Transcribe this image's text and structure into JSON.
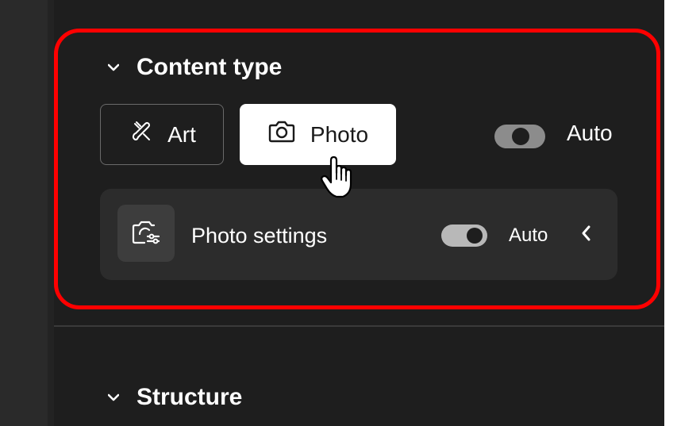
{
  "sections": {
    "content_type": {
      "title": "Content type",
      "art_label": "Art",
      "photo_label": "Photo",
      "auto_label": "Auto",
      "auto_enabled": false,
      "selected": "Photo"
    },
    "photo_settings": {
      "label": "Photo settings",
      "auto_label": "Auto",
      "auto_enabled": true
    },
    "structure": {
      "title": "Structure"
    }
  },
  "colors": {
    "panel_bg": "#1e1e1e",
    "highlight": "#ff0000",
    "selected_button_bg": "#ffffff"
  }
}
